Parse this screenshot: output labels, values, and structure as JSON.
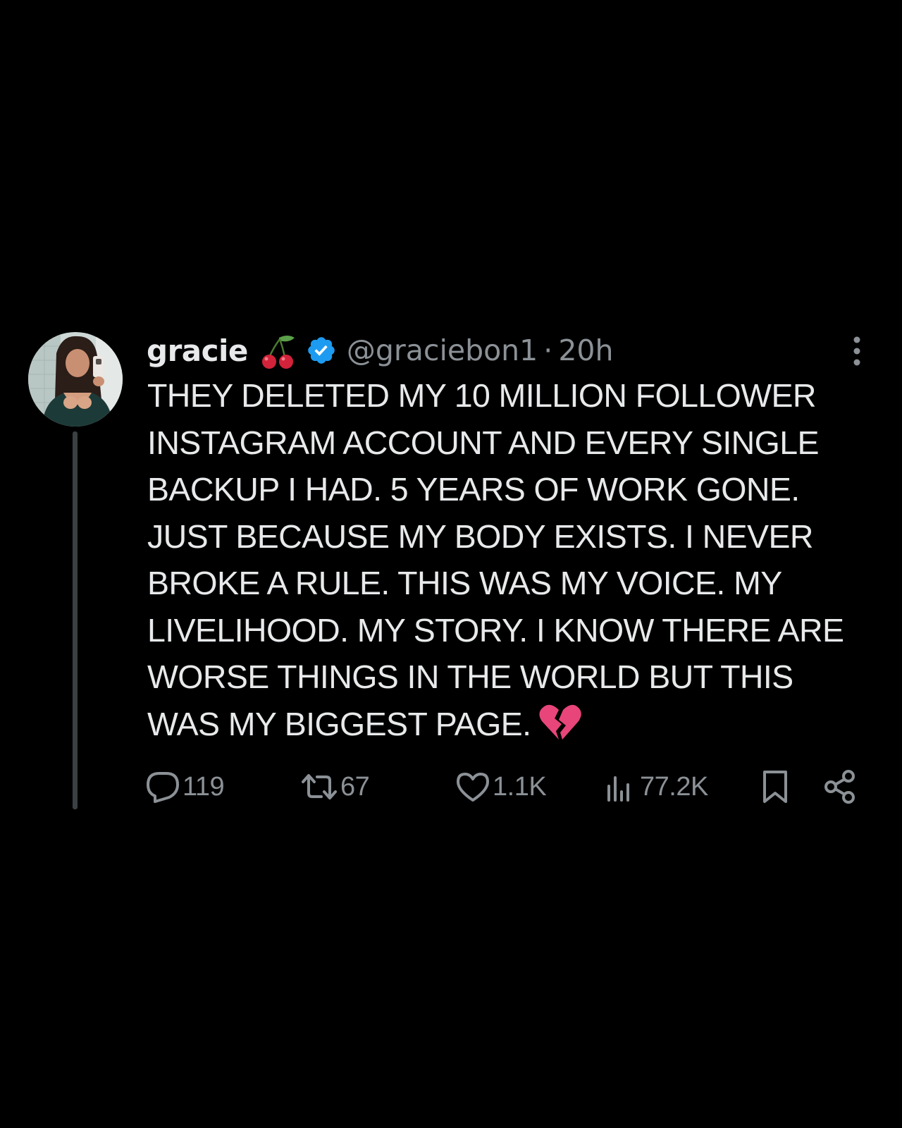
{
  "tweet": {
    "display_name": "gracie",
    "name_emoji": "cherries",
    "verified": true,
    "handle": "@graciebon1",
    "separator": "·",
    "time": "20h",
    "body_lines": [
      "THEY DELETED MY 10 MILLION FOLLOWER",
      "INSTAGRAM ACCOUNT AND EVERY SINGLE",
      "BACKUP I HAD. 5 YEARS OF WORK GONE.",
      "JUST BECAUSE MY BODY EXISTS. I NEVER",
      "BROKE A RULE. THIS WAS MY VOICE. MY",
      "LIVELIHOOD. MY STORY. I KNOW THERE ARE",
      "WORSE THINGS IN THE WORLD BUT THIS",
      "WAS MY BIGGEST PAGE."
    ],
    "trailing_emoji": "broken-heart",
    "stats": {
      "replies": "119",
      "reposts": "67",
      "likes": "1.1K",
      "views": "77.2K"
    }
  },
  "colors": {
    "background": "#000000",
    "text_primary": "#e7e9ea",
    "text_secondary": "#8b9196",
    "verified_blue": "#1d9bf0",
    "thread_line": "#3b4043",
    "broken_heart": "#e8457a"
  },
  "icons": {
    "avatar": "profile-photo",
    "more": "more-vertical-icon",
    "reply": "reply-icon",
    "repost": "repost-icon",
    "like": "heart-icon",
    "views": "bar-chart-icon",
    "bookmark": "bookmark-icon",
    "share": "share-icon"
  }
}
